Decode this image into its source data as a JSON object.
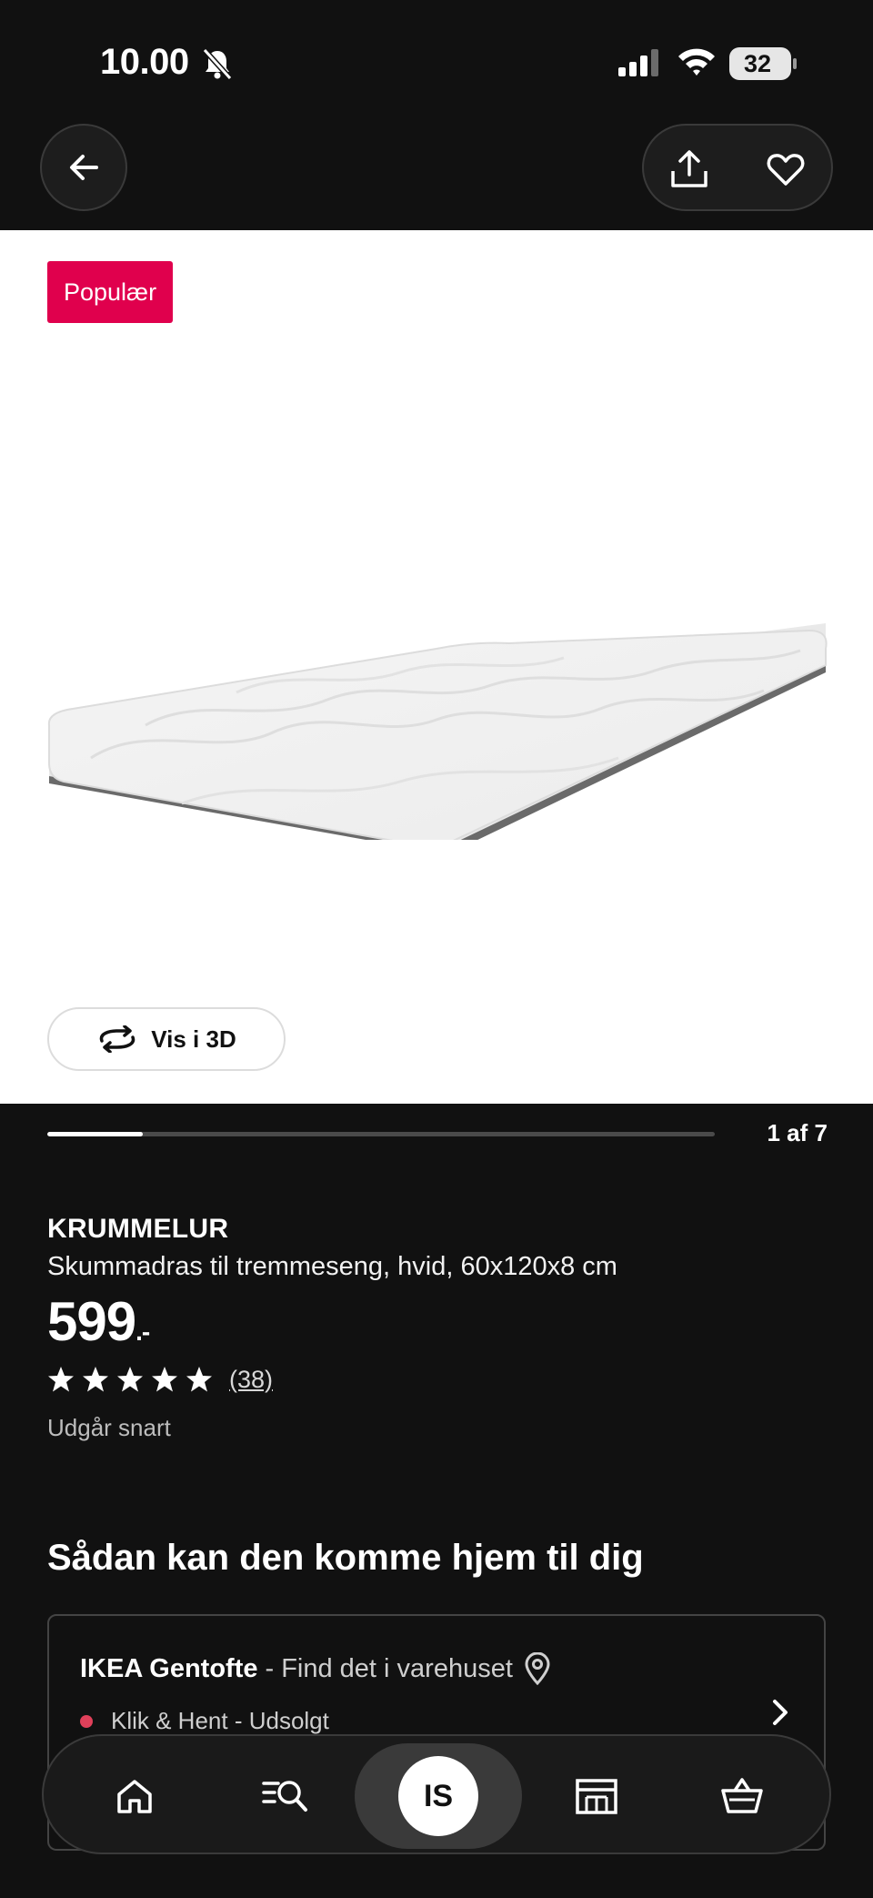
{
  "status_bar": {
    "time": "10.00",
    "battery": "32"
  },
  "header": {
    "back_icon": "arrow-left-icon",
    "share_icon": "share-icon",
    "favorite_icon": "heart-icon"
  },
  "gallery": {
    "badge": "Populær",
    "view_3d_label": "Vis i 3D",
    "counter": "1 af 7",
    "current": 1,
    "total": 7
  },
  "product": {
    "name": "KRUMMELUR",
    "description": "Skummadras til tremmeseng, hvid, 60x120x8 cm",
    "price": "599",
    "price_suffix": ".-",
    "rating_stars": 5,
    "review_count": "(38)",
    "status_note": "Udgår snart"
  },
  "delivery": {
    "title": "Sådan kan den komme hjem til dig",
    "store_name": "IKEA Gentofte",
    "store_sub": "- Find det i varehuset",
    "availability": "Klik & Hent - Udsolgt",
    "availability_color": "#e0405a"
  },
  "bottom_nav": {
    "items": [
      {
        "icon": "home-icon"
      },
      {
        "icon": "search-list-icon"
      },
      {
        "icon": "avatar",
        "label": "IS"
      },
      {
        "icon": "store-icon"
      },
      {
        "icon": "basket-icon"
      }
    ]
  },
  "colors": {
    "background": "#111111",
    "badge": "#e0004d"
  }
}
